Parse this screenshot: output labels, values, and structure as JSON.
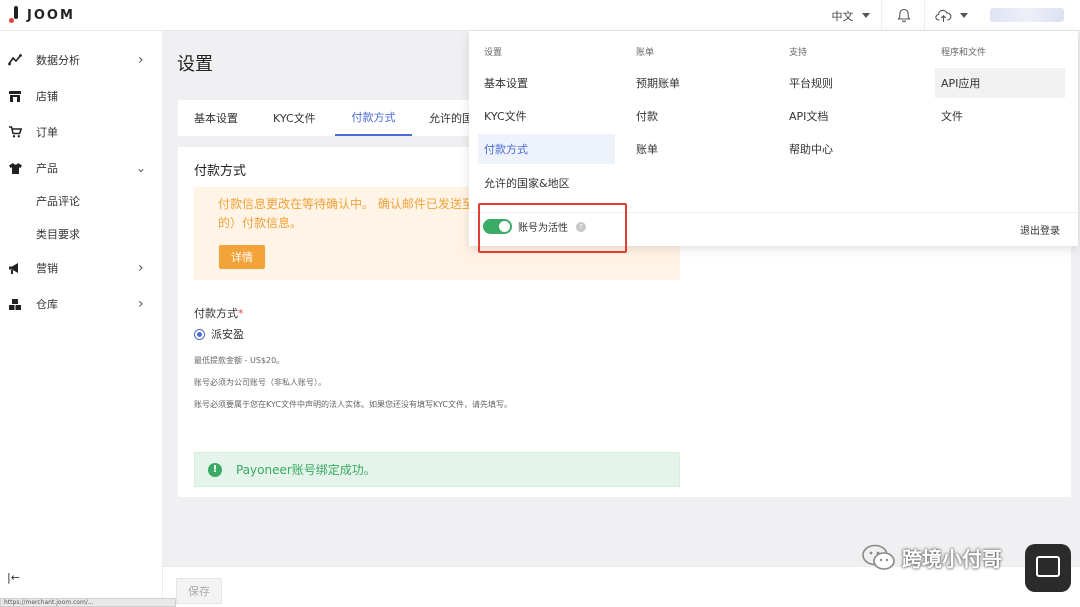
{
  "app": {
    "logo_text": "JOOM"
  },
  "header": {
    "language": "中文"
  },
  "sidebar": {
    "items": [
      {
        "label": "数据分析",
        "icon": "chart-line-icon",
        "chevron": "right"
      },
      {
        "label": "店铺",
        "icon": "store-icon",
        "chevron": ""
      },
      {
        "label": "订单",
        "icon": "cart-icon",
        "chevron": ""
      },
      {
        "label": "产品",
        "icon": "tshirt-icon",
        "chevron": "down"
      },
      {
        "label": "营销",
        "icon": "megaphone-icon",
        "chevron": "right"
      },
      {
        "label": "仓库",
        "icon": "warehouse-icon",
        "chevron": "right"
      }
    ],
    "sub_items": [
      "产品评论",
      "类目要求"
    ]
  },
  "main": {
    "title": "设置",
    "tabs": [
      "基本设置",
      "KYC文件",
      "付款方式",
      "允许的国"
    ],
    "active_tab": 2,
    "card": {
      "title": "付款方式",
      "warning_line1": "付款信息更改在等待确认中。 确认邮件已发送至",
      "warning_line2": "的）付款信息。",
      "details_button": "详情",
      "payment_method_label": "付款方式",
      "required_mark": "*",
      "selected_option": "派安盈",
      "notes": [
        "最低提款金额 - US$20。",
        "账号必须为公司账号（非私人账号）。",
        "账号必须要属于您在KYC文件中声明的法人实体。如果您还没有填写KYC文件，请先填写。"
      ],
      "success_message": "Payoneer账号绑定成功。"
    },
    "save_button": "保存"
  },
  "dropdown": {
    "columns": [
      {
        "header": "设置",
        "items": [
          "基本设置",
          "KYC文件",
          "付款方式",
          "允许的国家&地区"
        ]
      },
      {
        "header": "账单",
        "items": [
          "预期账单",
          "付款",
          "账单"
        ]
      },
      {
        "header": "支持",
        "items": [
          "平台规则",
          "API文档",
          "帮助中心"
        ]
      },
      {
        "header": "程序和文件",
        "items": [
          "API应用",
          "文件"
        ]
      }
    ],
    "account_toggle_label": "账号为活性",
    "help_mark": "?",
    "logout": "退出登录"
  },
  "status_bar": {
    "url": "https://merchant.joom.com/..."
  },
  "watermark": {
    "text": "跨境小付哥"
  }
}
